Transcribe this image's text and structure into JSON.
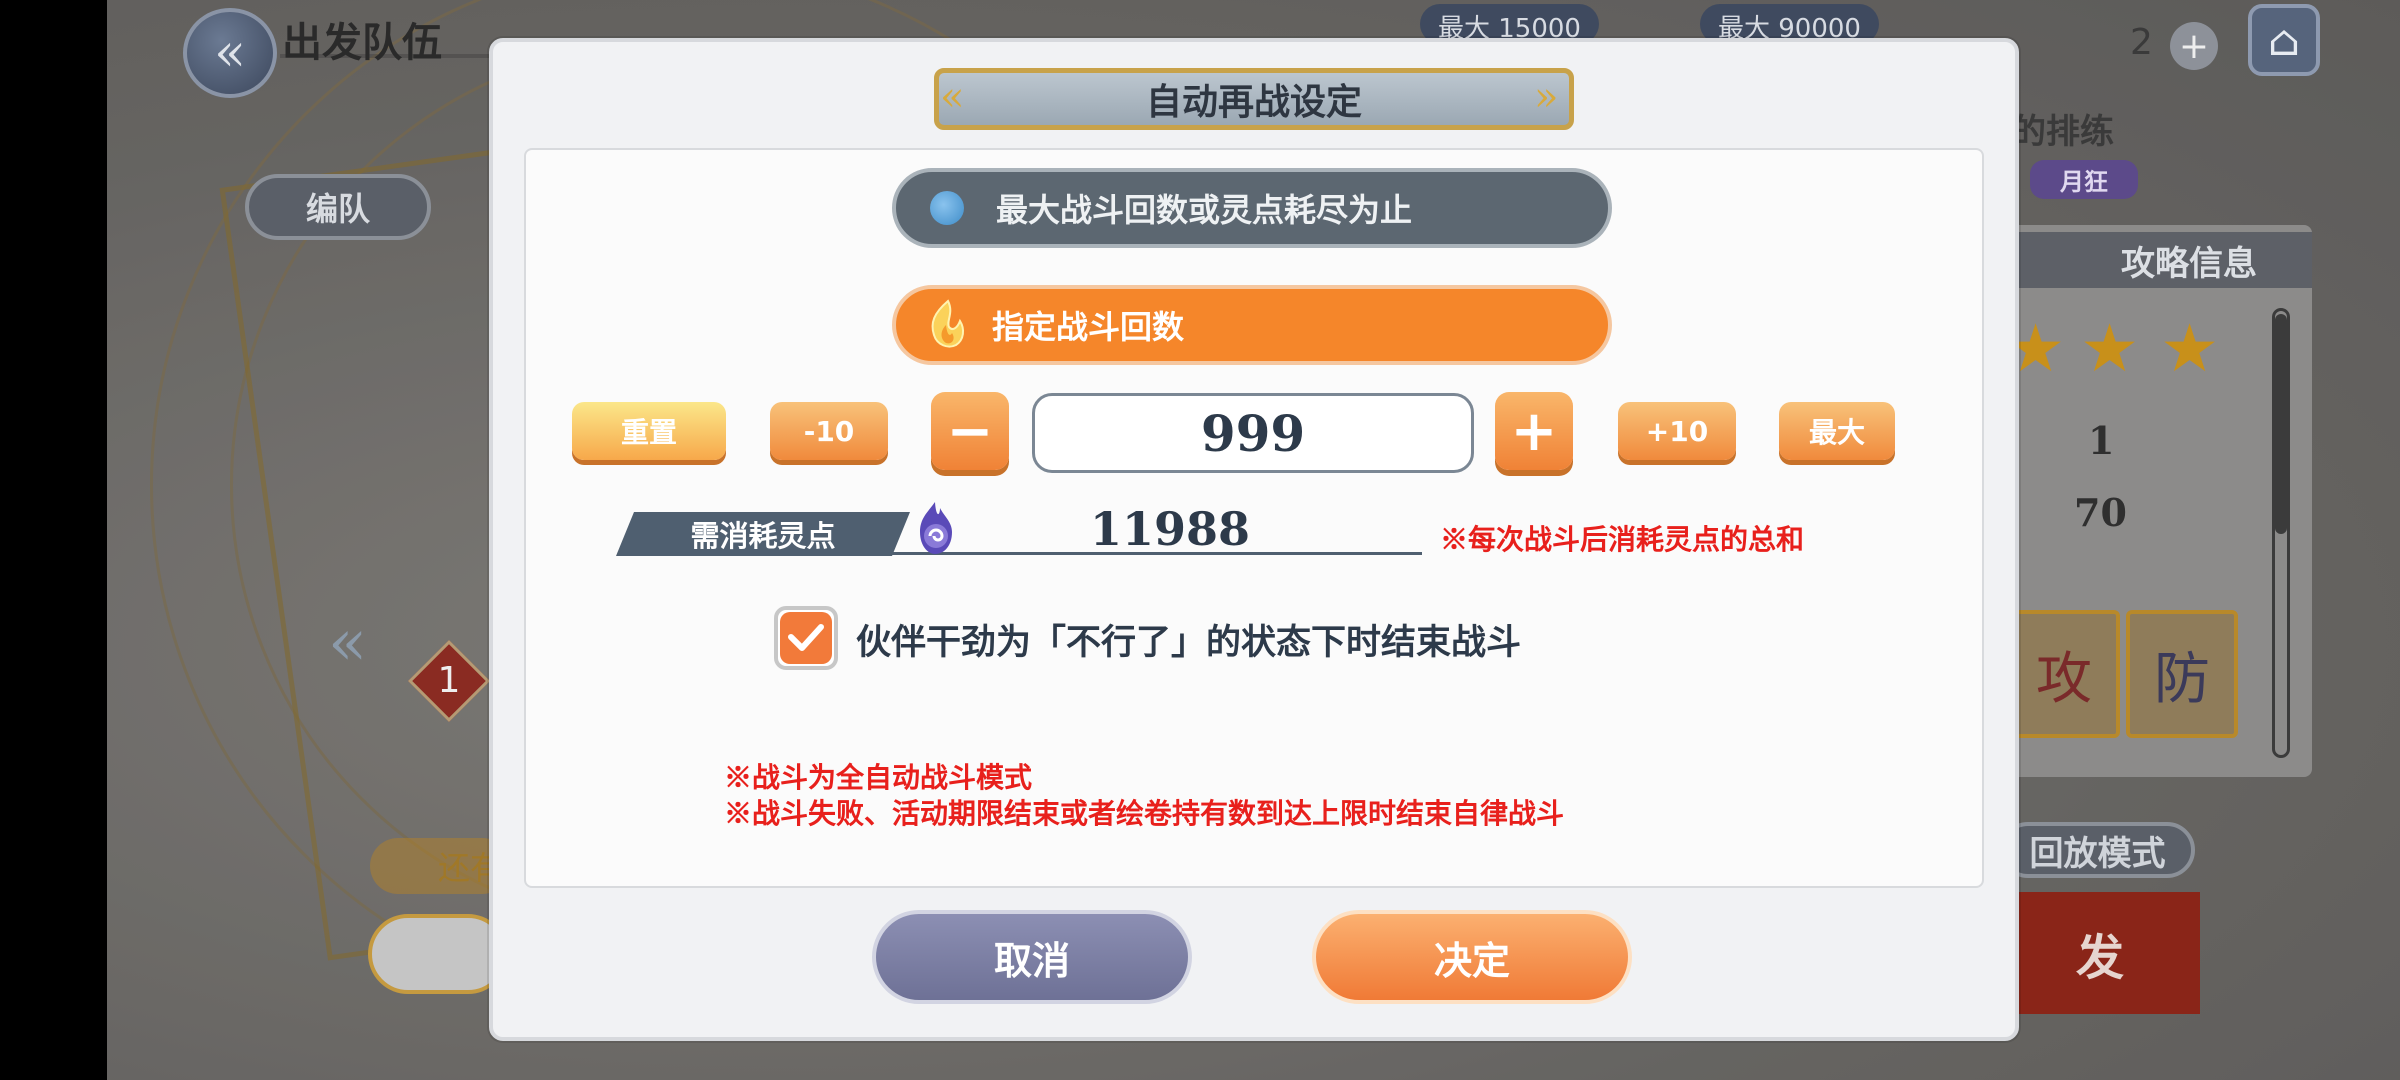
{
  "background": {
    "header_title": "出发队伍",
    "edit_team_label": "编队",
    "resource_1": "最大 15000",
    "resource_2": "最大 90000",
    "item_count": "2",
    "quest_title_fragment": "的排练",
    "quest_tag": "月狂",
    "info_title": "攻略信息",
    "info_value_1": "1",
    "info_value_2": "70",
    "card_1_glyph": "攻",
    "card_2_glyph": "防",
    "replay_mode_label": "回放模式",
    "start_label": "发",
    "left_badge_number": "1",
    "left_pill_text": "还有"
  },
  "dialog": {
    "title": "自动再战设定",
    "option_max_label": "最大战斗回数或灵点耗尽为止",
    "option_specified_label": "指定战斗回数",
    "reset_label": "重置",
    "minus10_label": "-10",
    "minus_label": "−",
    "count_value": "999",
    "plus_label": "+",
    "plus10_label": "+10",
    "max_label": "最大",
    "cost_label": "需消耗灵点",
    "cost_value": "11988",
    "cost_note": "※每次战斗后消耗灵点的总和",
    "checkbox_label": "伙伴干劲为「不行了」的状态下时结束战斗",
    "checkbox_checked": true,
    "note_1": "※战斗为全自动战斗模式",
    "note_2": "※战斗失败、活动期限结束或者绘卷持有数到达上限时结束自律战斗",
    "cancel_label": "取消",
    "confirm_label": "决定"
  },
  "colors": {
    "accent_orange": "#f5862a",
    "note_red": "#e8201c",
    "option_gray": "#5c6771",
    "cancel_purple": "#7d80a5"
  }
}
